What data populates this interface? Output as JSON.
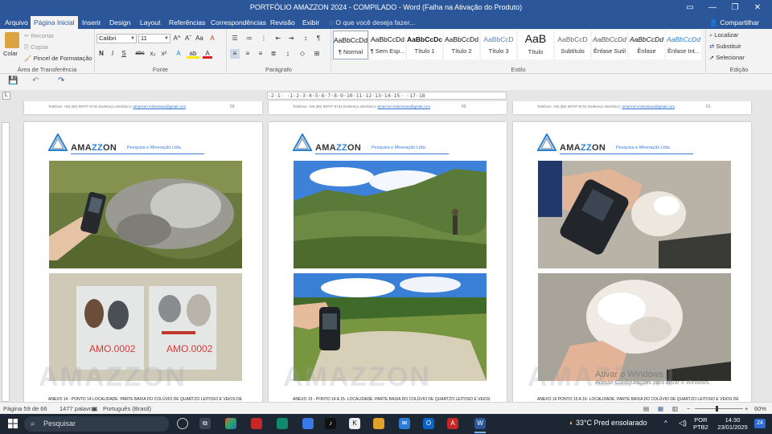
{
  "window": {
    "title": "PORTFÓLIO AMAZZON 2024 - COMPILADO - Word (Falha na Ativação do Produto)",
    "controls": [
      "▭",
      "—",
      "❐",
      "✕"
    ]
  },
  "tabs": [
    {
      "label": "Arquivo"
    },
    {
      "label": "Página Inicial"
    },
    {
      "label": "Inserir"
    },
    {
      "label": "Design"
    },
    {
      "label": "Layout"
    },
    {
      "label": "Referências"
    },
    {
      "label": "Correspondências"
    },
    {
      "label": "Revisão"
    },
    {
      "label": "Exibir"
    }
  ],
  "tell_me": "O que você deseja fazer...",
  "share_label": "Compartilhar",
  "ribbon": {
    "clipboard": {
      "label": "Área de Transferência",
      "paste": "Colar",
      "cut": "Recortar",
      "copy": "Copiar",
      "format_painter": "Pincel de Formatação"
    },
    "font": {
      "label": "Fonte",
      "name": "Calibri",
      "size": "11",
      "bold": "N",
      "italic": "I",
      "underline": "S",
      "strike": "abc",
      "subscript": "x₂",
      "superscript": "x²",
      "grow": "A^",
      "shrink": "Aˇ",
      "case": "Aa",
      "clear": "A",
      "effects": "A",
      "highlight": "ab",
      "color": "A"
    },
    "paragraph": {
      "label": "Parágrafo"
    },
    "styles": {
      "label": "Estilo",
      "items": [
        {
          "sample": "AaBbCcDd",
          "name": "¶ Normal"
        },
        {
          "sample": "AaBbCcDd",
          "name": "¶ Sem Esp..."
        },
        {
          "sample": "AaBbCcDc",
          "name": "Título 1"
        },
        {
          "sample": "AaBbCcDd",
          "name": "Título 2"
        },
        {
          "sample": "AaBbCcD",
          "name": "Título 3"
        },
        {
          "sample": "AaB",
          "name": "Título"
        },
        {
          "sample": "AaBbCcD",
          "name": "Subtítulo"
        },
        {
          "sample": "AaBbCcDd",
          "name": "Ênfase Sutil"
        },
        {
          "sample": "AaBbCcDd",
          "name": "Ênfase"
        },
        {
          "sample": "AaBbCcDd",
          "name": "Ênfase Int..."
        }
      ]
    },
    "editing": {
      "label": "Edição",
      "find": "Localizar",
      "replace": "Substituir",
      "select": "Selecionar"
    }
  },
  "ruler": {
    "marks": "·2·1·  ·1·2·3·4·5·6·7·8·9·10·11·12·13·14·15·  ·17·18"
  },
  "pages": [
    {
      "prev_footer": "Telefone: +55 (66) 99707-8731  Endereço eletrônico:",
      "prev_email": "amazzon.mineracao@gmail.com",
      "prev_number": "59",
      "logo": {
        "brand_a": "AMA",
        "brand_zz": "ZZ",
        "brand_b": "ON",
        "sub": "Pesquisa e Mineração Ltda."
      },
      "watermark": "AMAZZON",
      "caption": "ANEXO 14 - PONTO 14  LOCALIDADE:  PARTE BAIXA DO COLÚVIO DE QUARTZO LEITOSO E VEIOS DE",
      "photo_labels": [
        "AMO.0002",
        "AMO.0002"
      ]
    },
    {
      "prev_footer": "Telefone: +55 (66) 99707-8731  Endereço eletrônico:",
      "prev_email": "amazzon.mineracao@gmail.com",
      "prev_number": "60",
      "logo": {
        "brand_a": "AMA",
        "brand_zz": "ZZ",
        "brand_b": "ON",
        "sub": "Pesquisa e Mineração Ltda."
      },
      "watermark": "AMAZZON",
      "caption": "ANEXO 15 - PONTO 14 A 15-  LOCALIDADE:  PARTE BAIXA DO COLÚVIO DE QUARTZO LEITOSO E VEIOS"
    },
    {
      "prev_footer": "Telefone: +55 (66) 99707-8731  Endereço eletrônico:",
      "prev_email": "amazzon.mineracao@gmail.com",
      "prev_number": "61",
      "logo": {
        "brand_a": "AMA",
        "brand_zz": "ZZ",
        "brand_b": "ON",
        "sub": "Pesquisa e Mineração Ltda."
      },
      "watermark": "AMAZZON",
      "caption": "ANEXO 16 PONTO 15 A 16-  LOCALIDADE:  PARTE BAIXA DO COLÚVIO DE QUARTZO LEITOSO E VEIOS DE"
    }
  ],
  "activation": {
    "line1": "Ativar o Windows",
    "line2": "Acesse Configurações para ativar o Windows."
  },
  "status": {
    "page": "Página 59 de 66",
    "words": "1477 palavras",
    "language": "Português (Brasil)",
    "zoom": "60%"
  },
  "taskbar": {
    "search": "Pesquisar",
    "weather": "33°C  Pred ensolarado",
    "lang1": "POR",
    "lang2": "PTB2",
    "time": "14:30",
    "date": "23/01/2025",
    "notifications": "24"
  },
  "colors": {
    "word_blue": "#2b579a",
    "brand_blue": "#2b7fd0"
  }
}
